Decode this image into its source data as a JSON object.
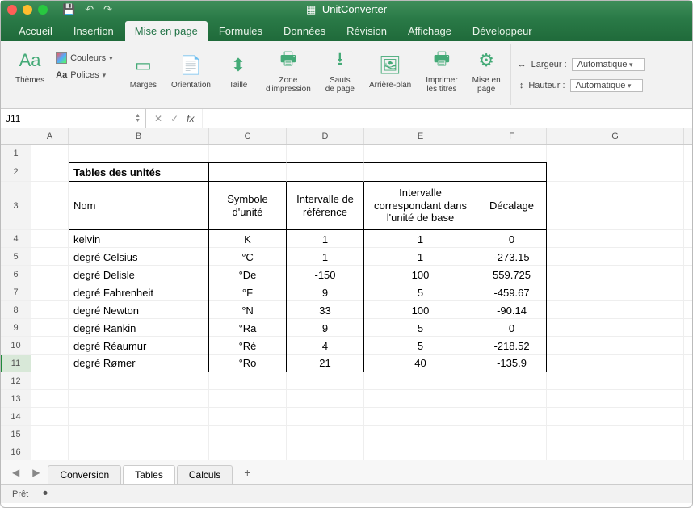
{
  "app": {
    "title": "UnitConverter"
  },
  "titlebar_tools": [
    "save-icon",
    "undo-icon",
    "redo-icon"
  ],
  "ribbon_tabs": [
    {
      "label": "Accueil"
    },
    {
      "label": "Insertion"
    },
    {
      "label": "Mise en page",
      "active": true
    },
    {
      "label": "Formules"
    },
    {
      "label": "Données"
    },
    {
      "label": "Révision"
    },
    {
      "label": "Affichage"
    },
    {
      "label": "Développeur"
    }
  ],
  "ribbon": {
    "themes_label": "Thèmes",
    "colors_label": "Couleurs",
    "fonts_label": "Polices",
    "margins": "Marges",
    "orientation": "Orientation",
    "size": "Taille",
    "print_area": "Zone\nd'impression",
    "breaks": "Sauts\nde page",
    "background": "Arrière-plan",
    "print_titles": "Imprimer\nles titres",
    "page_setup": "Mise en\npage",
    "width_label": "Largeur :",
    "height_label": "Hauteur :",
    "width_value": "Automatique",
    "height_value": "Automatique"
  },
  "namebox": "J11",
  "formula": "",
  "columns": [
    "A",
    "B",
    "C",
    "D",
    "E",
    "F",
    "G"
  ],
  "row_heights": {
    "default": 22,
    "r2": 24,
    "r3": 60
  },
  "table": {
    "title": "Tables des unités",
    "headers": [
      "Nom",
      "Symbole d'unité",
      "Intervalle de référence",
      "Intervalle correspondant dans l'unité de base",
      "Décalage"
    ],
    "rows": [
      {
        "nom": "kelvin",
        "sym": "K",
        "ref": "1",
        "base": "1",
        "dec": "0"
      },
      {
        "nom": "degré Celsius",
        "sym": "°C",
        "ref": "1",
        "base": "1",
        "dec": "-273.15"
      },
      {
        "nom": "degré Delisle",
        "sym": "°De",
        "ref": "-150",
        "base": "100",
        "dec": "559.725"
      },
      {
        "nom": "degré Fahrenheit",
        "sym": "°F",
        "ref": "9",
        "base": "5",
        "dec": "-459.67"
      },
      {
        "nom": "degré Newton",
        "sym": "°N",
        "ref": "33",
        "base": "100",
        "dec": "-90.14"
      },
      {
        "nom": "degré Rankin",
        "sym": "°Ra",
        "ref": "9",
        "base": "5",
        "dec": "0"
      },
      {
        "nom": "degré Réaumur",
        "sym": "°Ré",
        "ref": "4",
        "base": "5",
        "dec": "-218.52"
      },
      {
        "nom": "degré Rømer",
        "sym": "°Ro",
        "ref": "21",
        "base": "40",
        "dec": "-135.9"
      }
    ]
  },
  "sheets": [
    {
      "name": "Conversion"
    },
    {
      "name": "Tables",
      "active": true
    },
    {
      "name": "Calculs"
    }
  ],
  "status": "Prêt",
  "chart_data": {
    "type": "table",
    "title": "Tables des unités",
    "columns": [
      "Nom",
      "Symbole d'unité",
      "Intervalle de référence",
      "Intervalle correspondant dans l'unité de base",
      "Décalage"
    ],
    "rows": [
      [
        "kelvin",
        "K",
        1,
        1,
        0
      ],
      [
        "degré Celsius",
        "°C",
        1,
        1,
        -273.15
      ],
      [
        "degré Delisle",
        "°De",
        -150,
        100,
        559.725
      ],
      [
        "degré Fahrenheit",
        "°F",
        9,
        5,
        -459.67
      ],
      [
        "degré Newton",
        "°N",
        33,
        100,
        -90.14
      ],
      [
        "degré Rankin",
        "°Ra",
        9,
        5,
        0
      ],
      [
        "degré Réaumur",
        "°Ré",
        4,
        5,
        -218.52
      ],
      [
        "degré Rømer",
        "°Ro",
        21,
        40,
        -135.9
      ]
    ]
  }
}
